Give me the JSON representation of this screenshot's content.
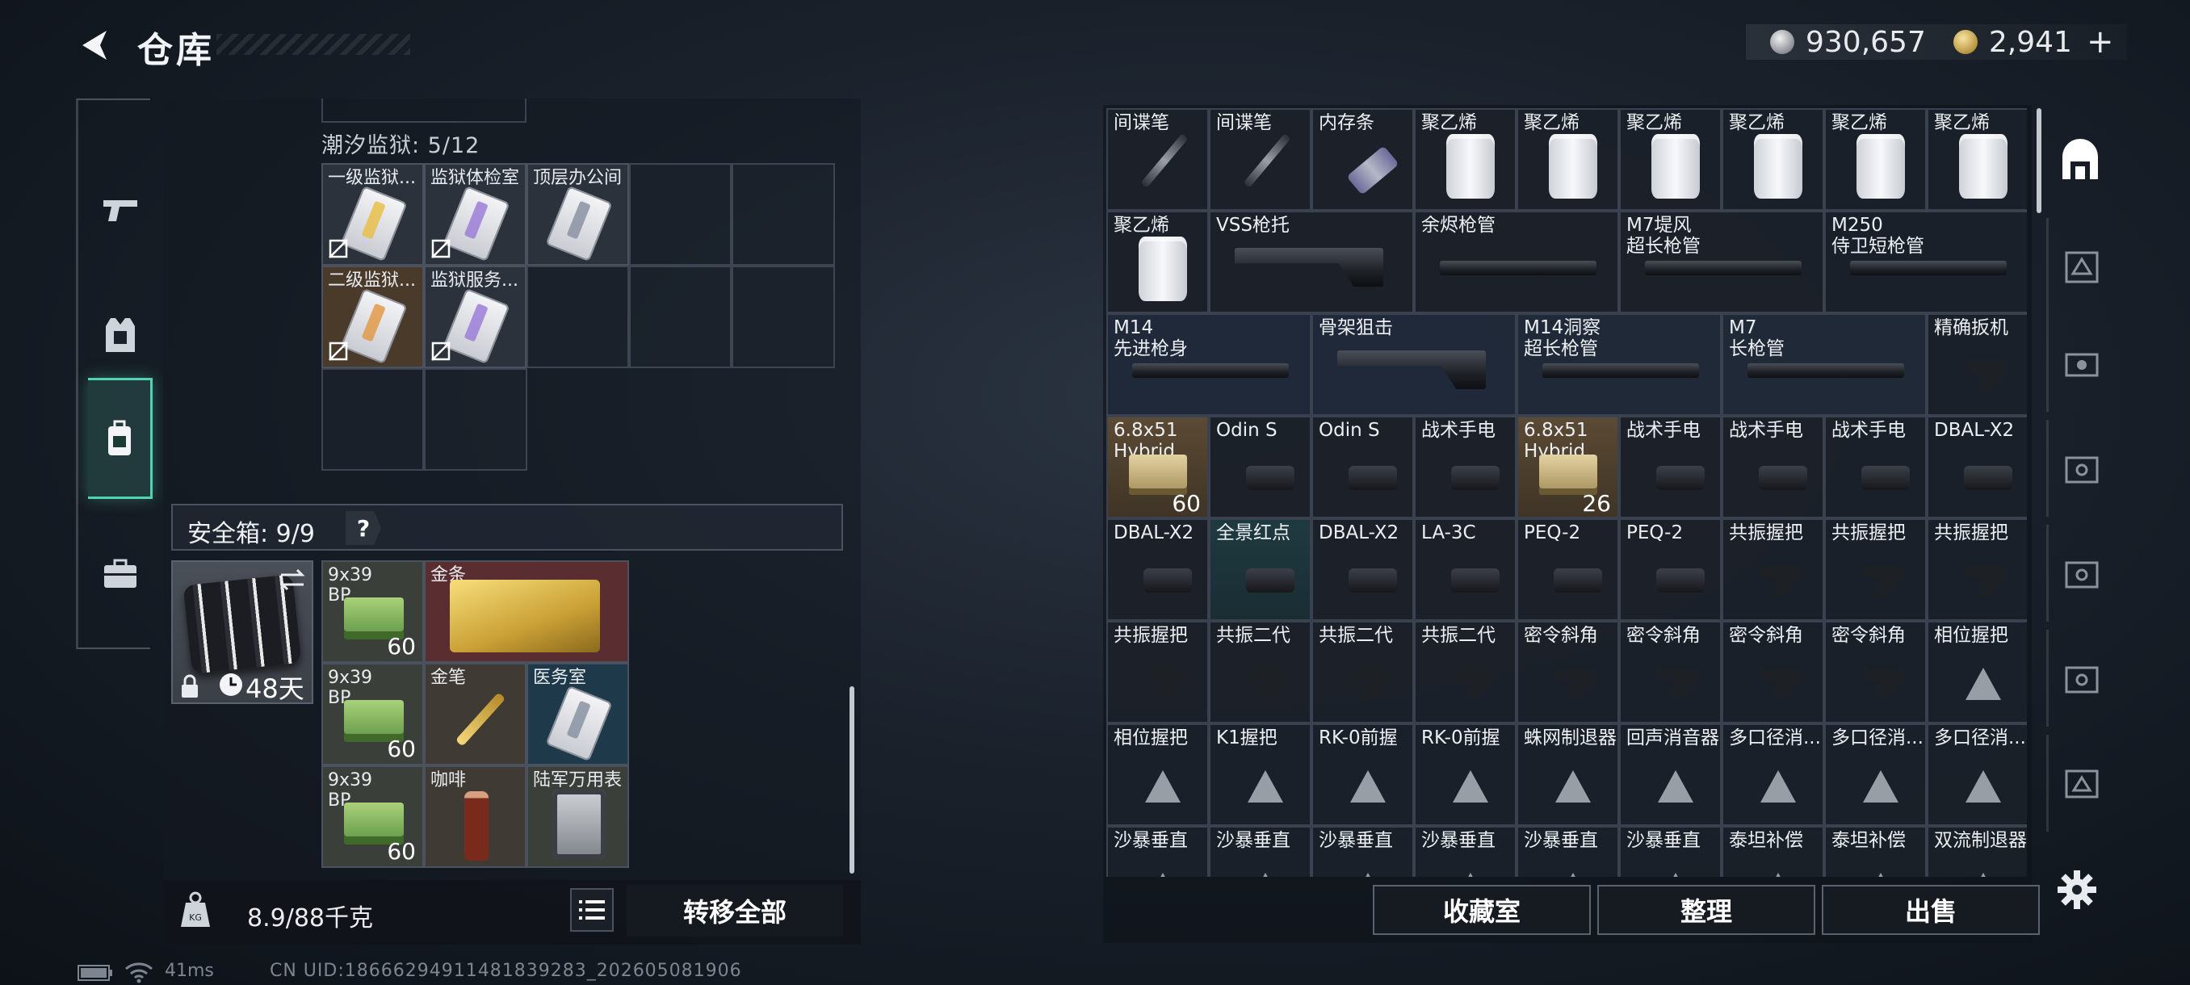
{
  "header": {
    "title": "仓库",
    "currency_silver": "930,657",
    "currency_gold": "2,941",
    "plus": "+"
  },
  "left_nav": [
    {
      "name": "nav-weapons",
      "icon": "gun-icon"
    },
    {
      "name": "nav-equipment",
      "icon": "vest-icon"
    },
    {
      "name": "nav-backpack",
      "icon": "backpack-icon",
      "active": true
    },
    {
      "name": "nav-case",
      "icon": "briefcase-icon"
    }
  ],
  "left": {
    "tidal_label": "潮汐监狱: 5/12",
    "keycards": [
      {
        "name": "一级监狱...",
        "color": "#e8c04a"
      },
      {
        "name": "监狱体检室",
        "color": "#9b7fd8"
      },
      {
        "name": "顶层办公间",
        "color": "#8a93a3"
      },
      {
        "name": "二级监狱...",
        "color": "#e39a4a"
      },
      {
        "name": "监狱服务...",
        "color": "#9b7fd8"
      }
    ],
    "safebox_label": "安全箱: 9/9",
    "safebox_help": "?",
    "case_days": "48天",
    "safe_items": [
      {
        "name": "9x39\nBP",
        "count": "60"
      },
      {
        "name": "金条",
        "count": ""
      },
      {
        "name": "9x39\nBP",
        "count": "60"
      },
      {
        "name": "金笔",
        "count": ""
      },
      {
        "name": "医务室",
        "count": ""
      },
      {
        "name": "9x39\nBP",
        "count": "60"
      },
      {
        "name": "咖啡",
        "count": ""
      },
      {
        "name": "陆军万用表",
        "count": ""
      }
    ],
    "weight": "8.9/88千克",
    "transfer_all": "转移全部"
  },
  "right": {
    "items": [
      "间谍笔",
      "间谍笔",
      "内存条",
      "聚乙烯",
      "聚乙烯",
      "聚乙烯",
      "聚乙烯",
      "聚乙烯",
      "聚乙烯",
      "聚乙烯",
      "VSS枪托",
      "余烬枪管",
      "M7堤风\n超长枪管",
      "M250\n侍卫短枪管",
      "M14\n先进枪身",
      "骨架狙击",
      "M14洞察\n超长枪管",
      "M7\n长枪管",
      "精确扳机",
      "6.8x51\nHybrid",
      "Odin S",
      "Odin S",
      "战术手电",
      "6.8x51\nHybrid",
      "战术手电",
      "战术手电",
      "战术手电",
      "DBAL-X2",
      "DBAL-X2",
      "全景红点",
      "DBAL-X2",
      "LA-3C",
      "PEQ-2",
      "PEQ-2",
      "共振握把",
      "共振握把",
      "共振握把",
      "共振握把",
      "共振二代",
      "共振二代",
      "共振二代",
      "密令斜角",
      "密令斜角",
      "密令斜角",
      "密令斜角",
      "相位握把",
      "相位握把",
      "K1握把",
      "RK-0前握",
      "RK-0前握",
      "蛛网制退器",
      "回声消音器",
      "多口径消...",
      "多口径消...",
      "多口径消...",
      "沙暴垂直",
      "沙暴垂直",
      "沙暴垂直",
      "沙暴垂直",
      "沙暴垂直",
      "沙暴垂直",
      "泰坦补偿",
      "泰坦补偿",
      "双流制退器"
    ],
    "ammo_counts": {
      "a": "60",
      "b": "26"
    },
    "collection": "收藏室",
    "sort": "整理",
    "sell": "出售"
  },
  "footer": {
    "ping": "41ms",
    "uid": "CN UID:18666294911481839283_202605081906"
  },
  "colors": {
    "accent": "#4fd3b0",
    "panel": "#141a21",
    "tile_border": "#3a4250"
  }
}
